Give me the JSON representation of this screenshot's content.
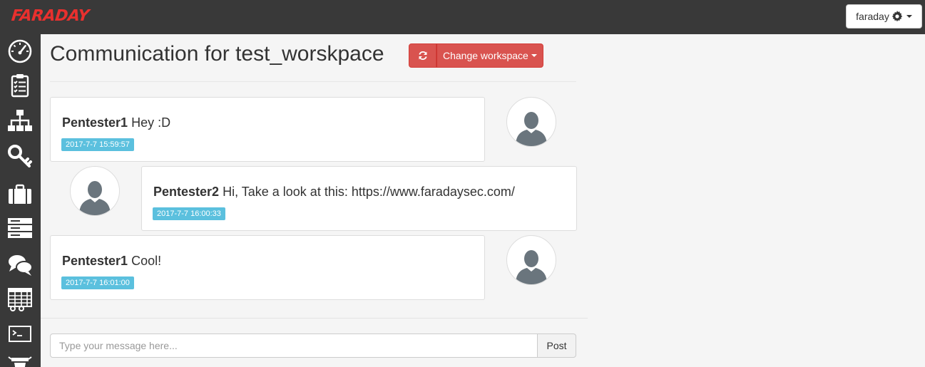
{
  "app": {
    "logo": "FARADAY"
  },
  "user_menu": {
    "label": "faraday"
  },
  "sidebar": {
    "items": [
      {
        "name": "dashboard",
        "icon": "speedometer-icon"
      },
      {
        "name": "status-report",
        "icon": "clipboard-checklist-icon"
      },
      {
        "name": "workspaces",
        "icon": "hierarchy-icon"
      },
      {
        "name": "credentials",
        "icon": "keys-icon"
      },
      {
        "name": "executive-report",
        "icon": "briefcase-icon"
      },
      {
        "name": "hosts",
        "icon": "servers-icon"
      },
      {
        "name": "communication",
        "icon": "chat-bubbles-icon"
      },
      {
        "name": "data-analysis",
        "icon": "table-grid-icon"
      },
      {
        "name": "terminal",
        "icon": "terminal-icon"
      },
      {
        "name": "extra",
        "icon": "bug-icon"
      }
    ]
  },
  "page": {
    "title": "Communication for test_worskpace",
    "refresh_icon": "refresh-icon",
    "change_workspace_label": "Change workspace"
  },
  "messages": [
    {
      "author": "Pentester1",
      "text": "Hey :D",
      "timestamp": "2017-7-7 15:59:57",
      "side": "left"
    },
    {
      "author": "Pentester2",
      "text": "Hi, Take a look at this: https://www.faradaysec.com/",
      "timestamp": "2017-7-7 16:00:33",
      "side": "right"
    },
    {
      "author": "Pentester1",
      "text": "Cool!",
      "timestamp": "2017-7-7 16:01:00",
      "side": "left"
    }
  ],
  "composer": {
    "placeholder": "Type your message here...",
    "post_label": "Post"
  },
  "colors": {
    "navbar": "#393939",
    "brand_red": "#e8302e",
    "danger_button": "#d9534f",
    "timestamp_badge": "#5bc0de",
    "avatar_gray": "#6a757d"
  }
}
